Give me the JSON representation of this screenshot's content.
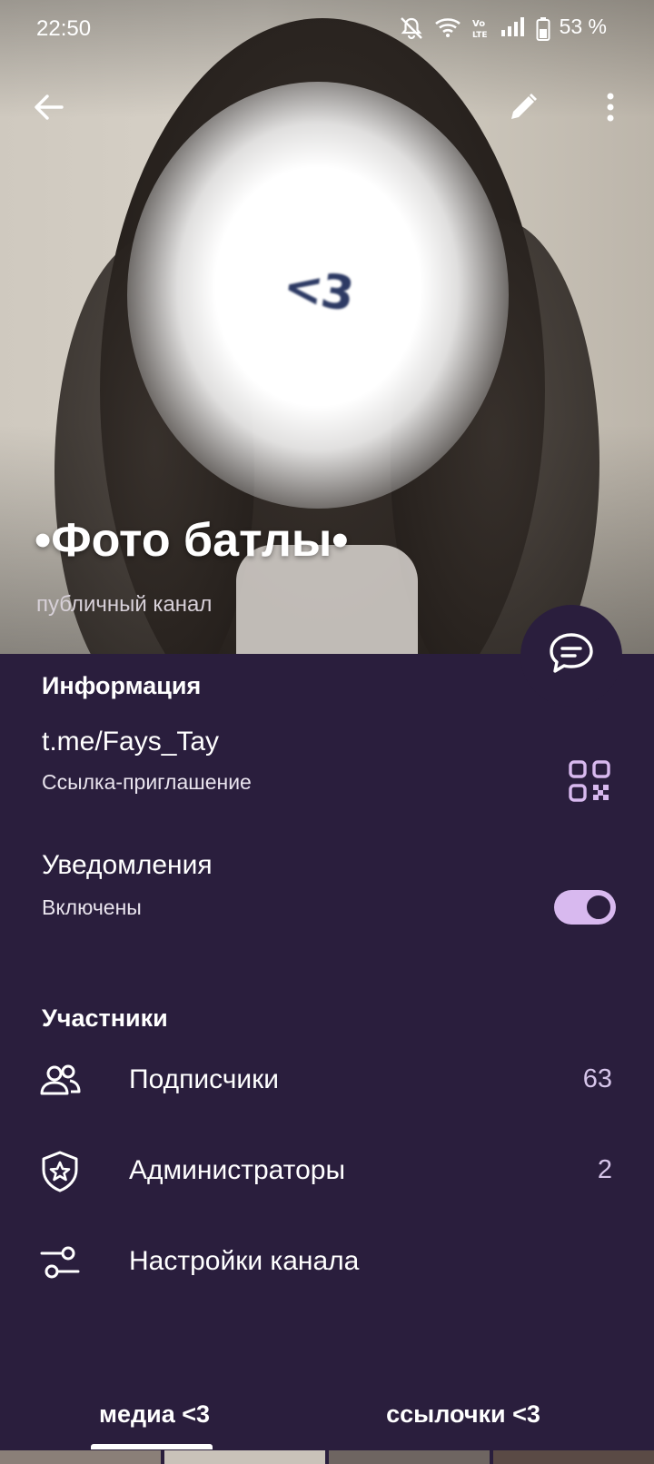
{
  "status_bar": {
    "time": "22:50",
    "icons": [
      "mute-icon",
      "wifi-icon",
      "volte-icon",
      "signal-icon",
      "battery-icon"
    ],
    "battery_percent": "53 %"
  },
  "hero": {
    "overlay_text": "<3",
    "title": "•Фото батлы•",
    "subtitle": "публичный канал"
  },
  "toolbar": {
    "back_icon": "arrow-left-icon",
    "edit_icon": "pencil-icon",
    "more_icon": "more-vertical-icon"
  },
  "fab": {
    "icon": "message-icon"
  },
  "info": {
    "section_title": "Информация",
    "link": "t.me/Fays_Tay",
    "link_caption": "Ссылка-приглашение",
    "qr_icon": "qr-code-icon",
    "notifications_label": "Уведомления",
    "notifications_state": "Включены",
    "notifications_on": true
  },
  "members": {
    "section_title": "Участники",
    "items": [
      {
        "icon": "users-icon",
        "label": "Подписчики",
        "count": "63"
      },
      {
        "icon": "shield-star-icon",
        "label": "Администраторы",
        "count": "2"
      },
      {
        "icon": "sliders-icon",
        "label": "Настройки канала",
        "count": ""
      }
    ]
  },
  "tabs": [
    {
      "label": "медиа <3",
      "active": true
    },
    {
      "label": "ссылочки <3",
      "active": false
    }
  ],
  "colors": {
    "panel_bg": "#2a1e3d",
    "accent": "#d8b9ef",
    "count_text": "#d6c5ea"
  }
}
